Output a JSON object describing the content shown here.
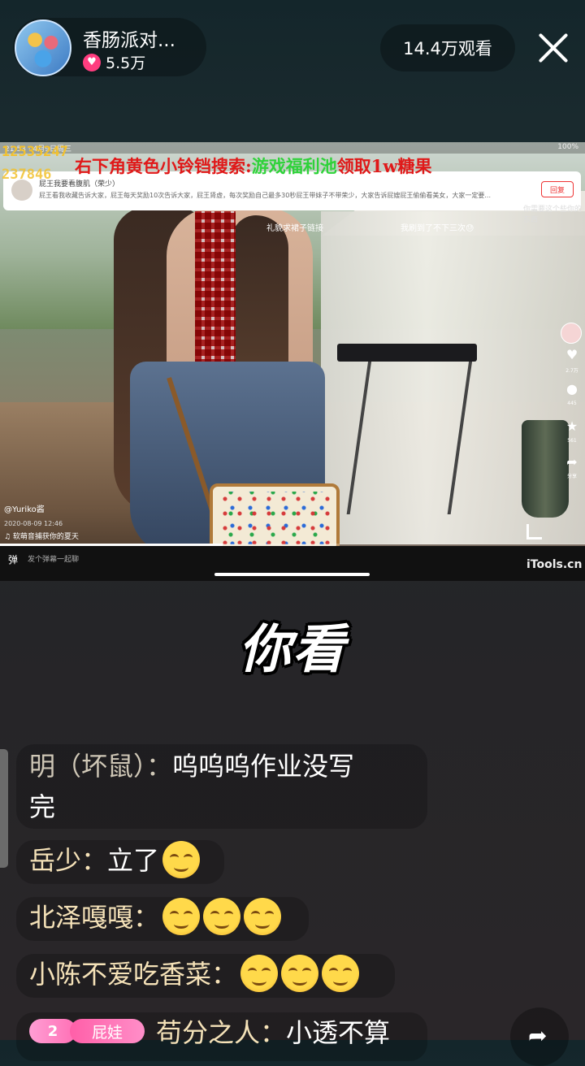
{
  "header": {
    "host_name": "香肠派对...",
    "likes": "5.5万",
    "viewers": "14.4万观看"
  },
  "video": {
    "status_time": "21:53 · 4月9日周三",
    "status_battery": "100%",
    "counter_1": "12535247",
    "counter_2": "237846",
    "promo_red": "右下角黄色小铃铛搜索:",
    "promo_green": "游戏福利池",
    "promo_red2": "领取1w糖果",
    "comment_title": "屁王我要看腹肌（荣少）",
    "comment_body": "屁王看我收藏告诉大家，屁王每天奖励10次告诉大家，屁王肾虚，每次奖励自己最多30秒屁王带妹子不带荣少，大家告诉屁嫂屁王偷偷看美女，大家一定要...",
    "comment_button": "回复",
    "sub_left": "礼貌求裙子链接",
    "sub_right": "我刷到了不下三次😓",
    "sub_corner": "你需要这个些你的东西",
    "author": "@Yuriko酱",
    "date": "2020-08-09 12:46",
    "music": "♫ 软萌音捕获你的夏天",
    "rail_counts": [
      "2.7万",
      "445",
      "561",
      "分享"
    ],
    "danmu_placeholder": "发个弹幕一起聊",
    "watermark": "iTools.cn",
    "progress": 0.38
  },
  "subtitle": "你看",
  "chat": [
    {
      "name": "明（坏鼠）：",
      "text": "呜呜呜作业没写",
      "text2": "完"
    },
    {
      "name": "岳少：",
      "text": "立了",
      "emojis": 1
    },
    {
      "name": "北泽嘎嘎：",
      "text": "",
      "emojis": 3
    },
    {
      "name": "小陈不爱吃香菜：",
      "text": "",
      "emojis": 3
    },
    {
      "level": "2",
      "fan_badge": "屁娃",
      "name": "苟分之人：",
      "text": "小透不算"
    }
  ],
  "icons": {
    "close": "close-icon",
    "heart": "heart-icon",
    "share": "share-icon"
  },
  "colors": {
    "promo_red": "#e01919",
    "promo_green": "#2fd23a",
    "counter_yellow": "#f2c12e",
    "likes_pink": "#ff3d7f"
  }
}
